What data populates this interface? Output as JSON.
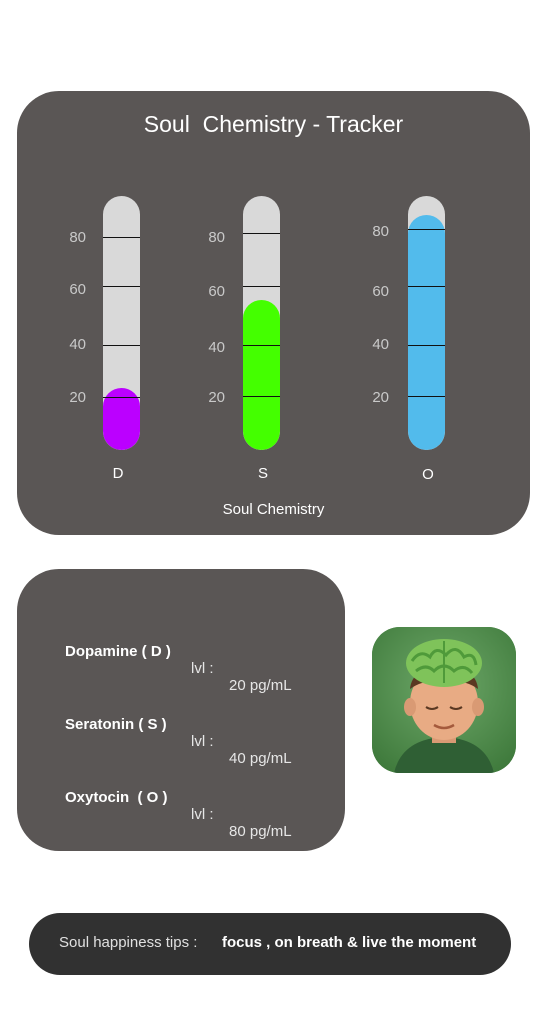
{
  "tracker": {
    "title": "Soul  Chemistry - Tracker",
    "footer": "Soul Chemistry",
    "scale_labels": [
      "80",
      "60",
      "40",
      "20"
    ],
    "tubes": [
      {
        "key": "D",
        "label": "D",
        "level": 20,
        "color": "#bb00ff"
      },
      {
        "key": "S",
        "label": "S",
        "level": 40,
        "color": "#44ff00"
      },
      {
        "key": "O",
        "label": "O",
        "level": 80,
        "color": "#52bbec"
      }
    ]
  },
  "levels": [
    {
      "name": "Dopamine ( D )",
      "lvl_label": "lvl :",
      "value": "20 pg/mL"
    },
    {
      "name": "Seratonin ( S )",
      "lvl_label": "lvl :",
      "value": "40 pg/mL"
    },
    {
      "name": "Oxytocin  ( O )",
      "lvl_label": "lvl :",
      "value": "80 pg/mL"
    }
  ],
  "avatar": {
    "icon": "brain-head-avatar-icon"
  },
  "tips": {
    "label": "Soul happiness tips :",
    "text": "focus , on breath & live the moment"
  }
}
